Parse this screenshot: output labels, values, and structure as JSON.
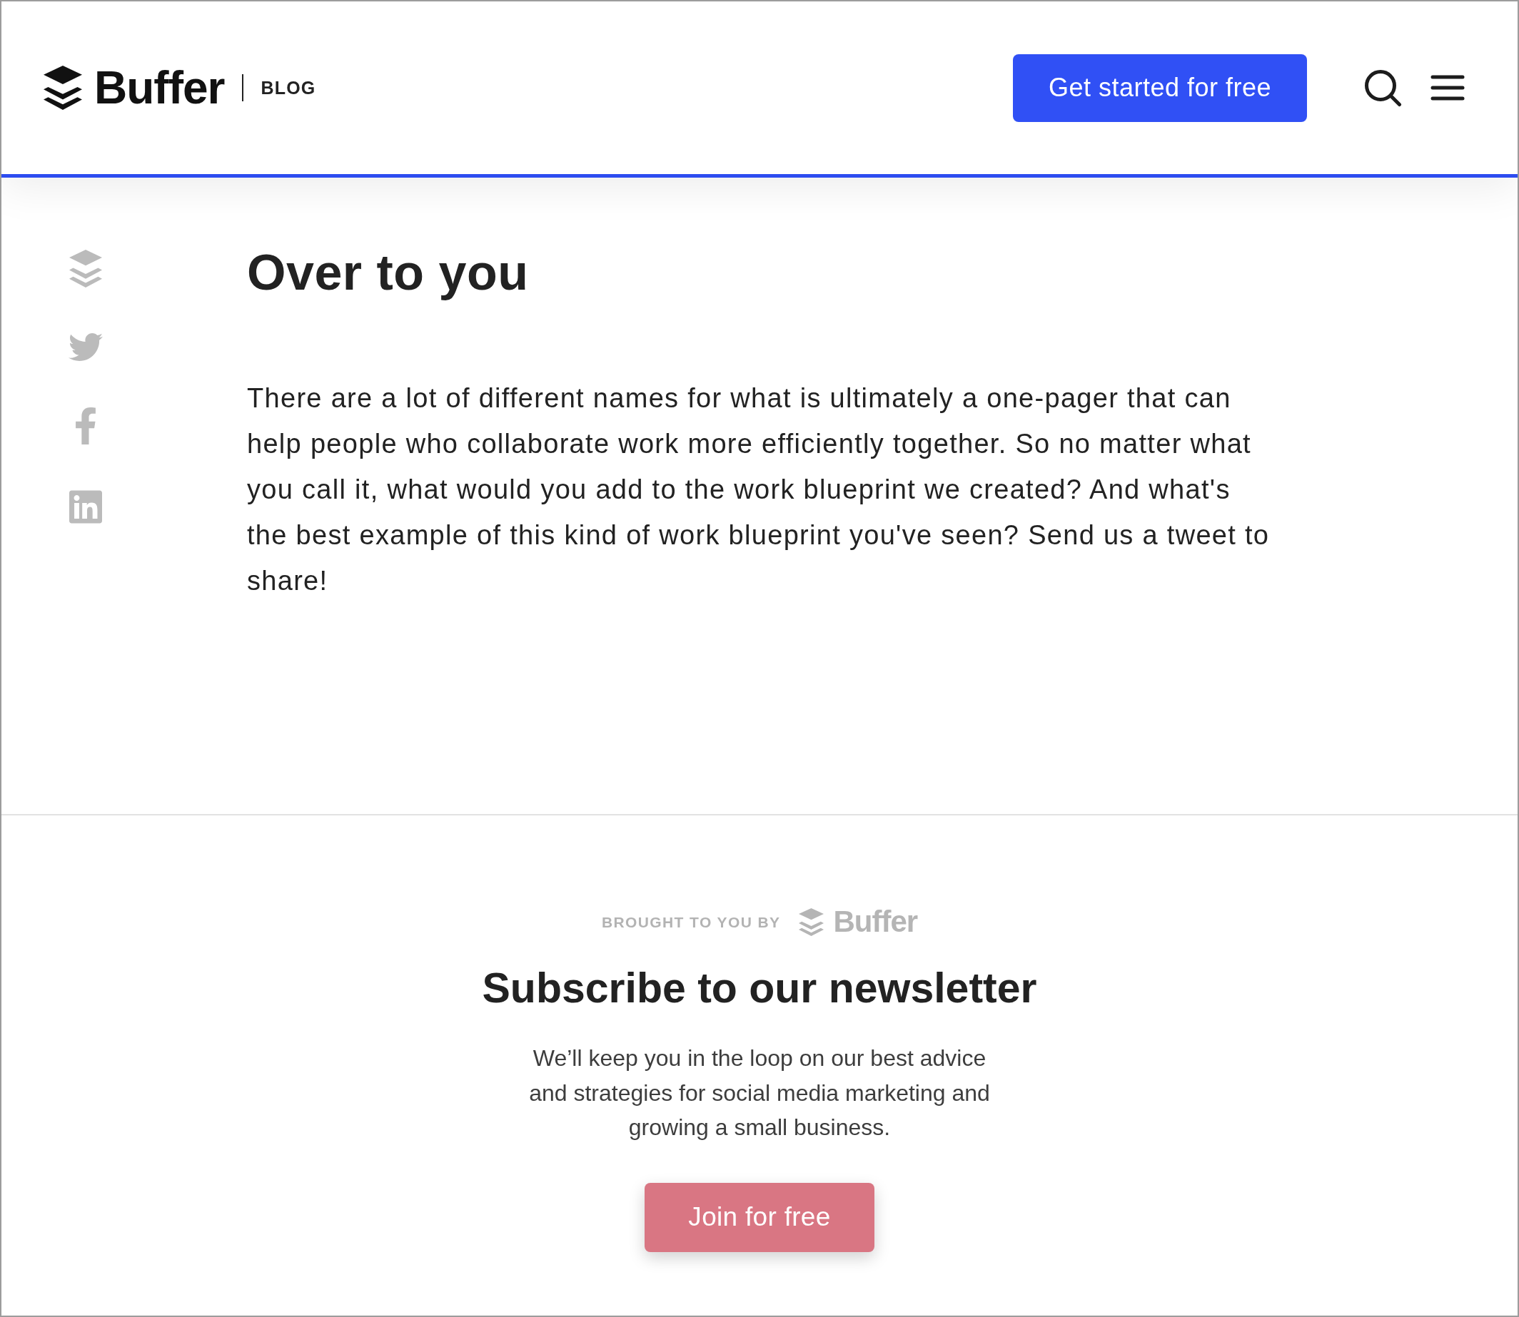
{
  "header": {
    "logo_text": "Buffer",
    "section_label": "BLOG",
    "cta_button": "Get started for free"
  },
  "article": {
    "heading": "Over to you",
    "paragraph": "There are a lot of different names for what is ultimately a one-pager that can help people who collaborate work more efficiently together. So no matter what you call it, what would you add to the work blueprint we created? And what's the best example of this kind of work blueprint you've seen? Send us a tweet to share!"
  },
  "newsletter": {
    "sponsor_label": "BROUGHT TO YOU BY",
    "sponsor_logo_text": "Buffer",
    "heading": "Subscribe to our newsletter",
    "description": "We’ll keep you in the loop on our best advice and strategies for social media marketing and growing a small business.",
    "button": "Join for free"
  }
}
